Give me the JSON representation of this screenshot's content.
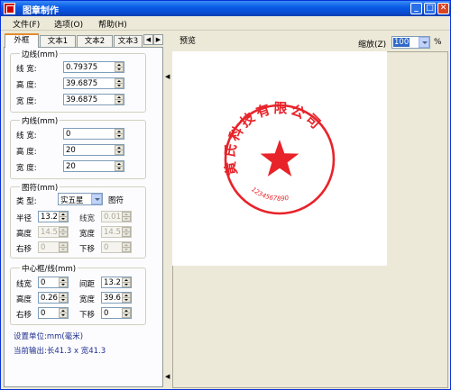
{
  "window": {
    "title": "图章制作"
  },
  "menu": [
    {
      "label": "文件(F)"
    },
    {
      "label": "选项(O)"
    },
    {
      "label": "帮助(H)"
    }
  ],
  "tabs": [
    {
      "label": "外框",
      "active": true
    },
    {
      "label": "文本1"
    },
    {
      "label": "文本2"
    },
    {
      "label": "文本3"
    }
  ],
  "border_group": {
    "title": "边线(mm)",
    "fields": [
      {
        "label": "线  宽:",
        "value": "0.79375"
      },
      {
        "label": "高  度:",
        "value": "39.6875"
      },
      {
        "label": "宽  度:",
        "value": "39.6875"
      }
    ]
  },
  "inner_group": {
    "title": "内线(mm)",
    "fields": [
      {
        "label": "线  宽:",
        "value": "0"
      },
      {
        "label": "高  度:",
        "value": "20"
      },
      {
        "label": "宽  度:",
        "value": "20"
      }
    ]
  },
  "symbol_group": {
    "title": "图符(mm)",
    "type_label": "类  型:",
    "type_value": "实五星",
    "symbol_button": "图符",
    "radius_label": "半径",
    "radius_value": "13.2",
    "linewidth_label": "线宽",
    "linewidth_value": "0.01",
    "height_label": "高度",
    "height_value": "14.5",
    "width_label": "宽度",
    "width_value": "14.5",
    "right_label": "右移",
    "right_value": "0",
    "down_label": "下移",
    "down_value": "0"
  },
  "center_group": {
    "title": "中心框/线(mm)",
    "linewidth_label": "线宽",
    "linewidth_value": "0",
    "spacing_label": "间距",
    "spacing_value": "13.2",
    "height_label": "高度",
    "height_value": "0.26",
    "width_label": "宽度",
    "width_value": "39.6",
    "right_label": "右移",
    "right_value": "0",
    "down_label": "下移",
    "down_value": "0"
  },
  "info": {
    "unit": "设置单位:mm(毫米)",
    "output": "当前输出:长41.3 x 宽41.3"
  },
  "preview": {
    "label": "预览",
    "zoom_label": "缩放(Z)",
    "zoom_value": "100",
    "zoom_unit": "%"
  },
  "stamp": {
    "color": "#e8232a",
    "arc_text": "黄氏科技有限公司",
    "serial": "1234567890"
  },
  "colors": {
    "titlebar": "#0a5ce6",
    "accent_tab": "#e68b2c",
    "stamp": "#e8232a"
  }
}
